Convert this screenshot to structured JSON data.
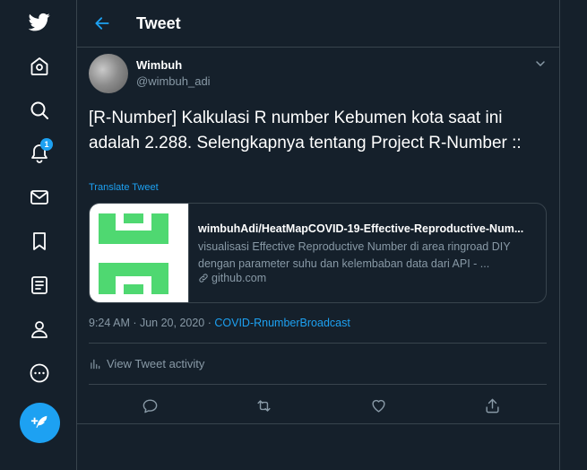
{
  "header": {
    "title": "Tweet"
  },
  "nav": {
    "notifications_badge": "1",
    "icons": [
      "twitter-logo-icon",
      "home-icon",
      "explore-icon",
      "notifications-icon",
      "messages-icon",
      "bookmarks-icon",
      "lists-icon",
      "profile-icon",
      "more-icon",
      "compose-icon"
    ]
  },
  "tweet": {
    "author_name": "Wimbuh",
    "author_handle": "@wimbuh_adi",
    "text": "[R-Number] Kalkulasi R number Kebumen kota saat ini adalah 2.288. Selengkapnya tentang Project R-Number ::",
    "translate_label": "Translate Tweet",
    "timestamp": "9:24 AM · Jun 20, 2020 · ",
    "source": "COVID-RnumberBroadcast",
    "activity_label": "View Tweet activity"
  },
  "card": {
    "title": "wimbuhAdi/HeatMapCOVID-19-Effective-Reproductive-Num...",
    "description": "visualisasi Effective Reproductive Number di area ringroad DIY dengan parameter suhu dan kelembaban data dari API - ...",
    "domain": "github.com"
  },
  "colors": {
    "background": "#15202b",
    "border": "#38444d",
    "accent": "#1da1f2",
    "muted": "#8899a6",
    "thumb_green": "#4fd871"
  }
}
